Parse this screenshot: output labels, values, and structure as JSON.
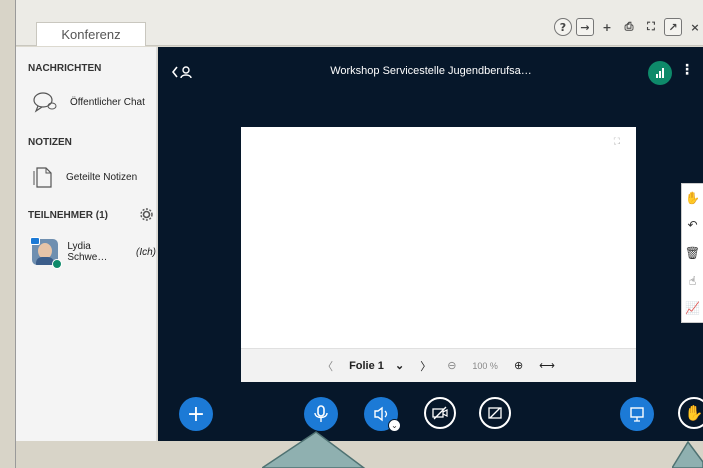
{
  "window": {
    "tab_label": "Konferenz"
  },
  "toolbar": {
    "icons": [
      "help-icon",
      "exit-icon",
      "add-user-icon",
      "print-icon",
      "expand-icon",
      "external-icon",
      "close-icon"
    ],
    "glyphs": [
      "?",
      "→",
      "+",
      "⎙",
      "⛶",
      "↗",
      "×"
    ]
  },
  "sidebar": {
    "messages_title": "NACHRICHTEN",
    "public_chat": "Öffentlicher Chat",
    "notes_title": "NOTIZEN",
    "shared_notes": "Geteilte Notizen",
    "participants_title": "TEILNEHMER (1)",
    "participant_name": "Lydia Schwe…",
    "participant_self": "(Ich)"
  },
  "main": {
    "title": "Workshop Servicestelle Jugendberufsa…",
    "slide_label": "Folie 1",
    "zoom": "100 %"
  },
  "colors": {
    "accent_blue": "#1c7ad6",
    "main_bg": "#06172a",
    "signal_green": "#0e8a6a"
  }
}
